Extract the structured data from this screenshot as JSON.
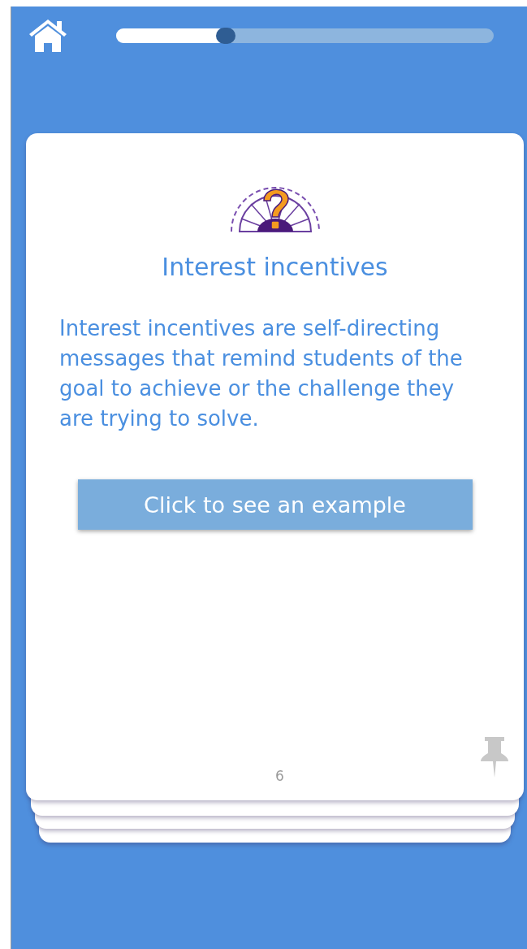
{
  "progress": {
    "level": 0.29
  },
  "card": {
    "title": "Interest incentives",
    "description": "Interest incentives are self-directing messages that remind students of the goal to achieve or the challenge they are trying to solve.",
    "button": "Click to see an example",
    "page_number": "6"
  }
}
